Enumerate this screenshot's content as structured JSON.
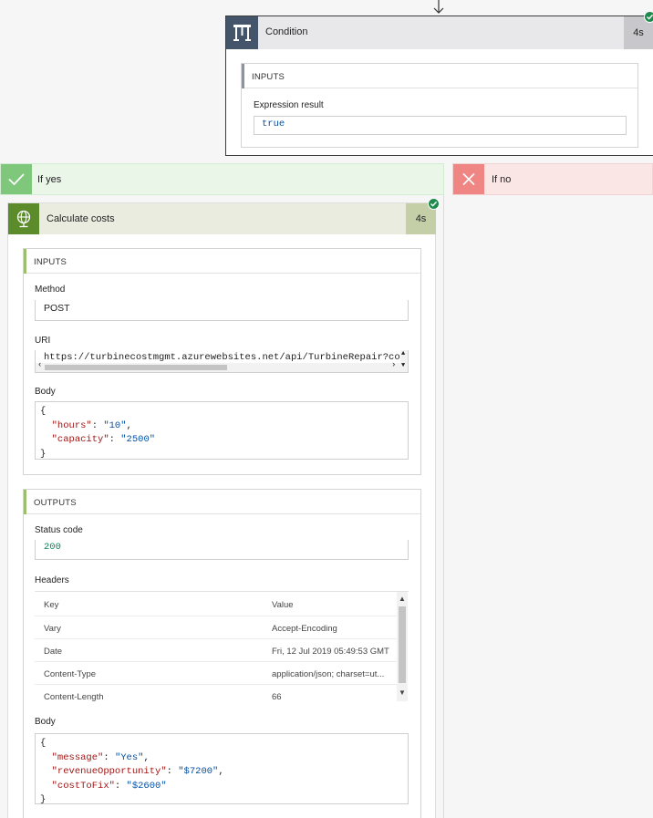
{
  "condition": {
    "title": "Condition",
    "duration": "4s",
    "inputs_header": "INPUTS",
    "expression_label": "Expression result",
    "expression_value": "true"
  },
  "branches": {
    "yes_label": "If yes",
    "no_label": "If no"
  },
  "action": {
    "title": "Calculate costs",
    "duration": "4s",
    "inputs": {
      "header": "INPUTS",
      "method_label": "Method",
      "method_value": "POST",
      "uri_label": "URI",
      "uri_value": "https://turbinecostmgmt.azurewebsites.net/api/TurbineRepair?code=",
      "body_label": "Body",
      "body_lines": [
        "{",
        "  \"hours\": \"10\",",
        "  \"capacity\": \"2500\"",
        "}"
      ],
      "body_open": "{",
      "body_close": "}",
      "body_fields": [
        {
          "key": "\"hours\"",
          "sep": ": ",
          "value": "\"10\"",
          "trail": ","
        },
        {
          "key": "\"capacity\"",
          "sep": ": ",
          "value": "\"2500\"",
          "trail": ""
        }
      ]
    },
    "outputs": {
      "header": "OUTPUTS",
      "status_label": "Status code",
      "status_value": "200",
      "headers_label": "Headers",
      "headers_columns": {
        "key": "Key",
        "value": "Value"
      },
      "headers_rows": [
        {
          "key": "Vary",
          "value": "Accept-Encoding"
        },
        {
          "key": "Date",
          "value": "Fri, 12 Jul 2019 05:49:53 GMT"
        },
        {
          "key": "Content-Type",
          "value": "application/json; charset=ut..."
        },
        {
          "key": "Content-Length",
          "value": "66"
        }
      ],
      "body_label": "Body",
      "body_open": "{",
      "body_close": "}",
      "body_fields": [
        {
          "key": "\"message\"",
          "sep": ": ",
          "value": "\"Yes\"",
          "trail": ","
        },
        {
          "key": "\"revenueOpportunity\"",
          "sep": ": ",
          "value": "\"$7200\"",
          "trail": ","
        },
        {
          "key": "\"costToFix\"",
          "sep": ": ",
          "value": "\"$2600\"",
          "trail": ""
        }
      ]
    }
  },
  "colors": {
    "condition_accent": "#43546b",
    "action_accent": "#5b8b2b",
    "yes_accent": "#7fc77b",
    "no_accent": "#f08684",
    "success_check": "#1f8a4c"
  }
}
